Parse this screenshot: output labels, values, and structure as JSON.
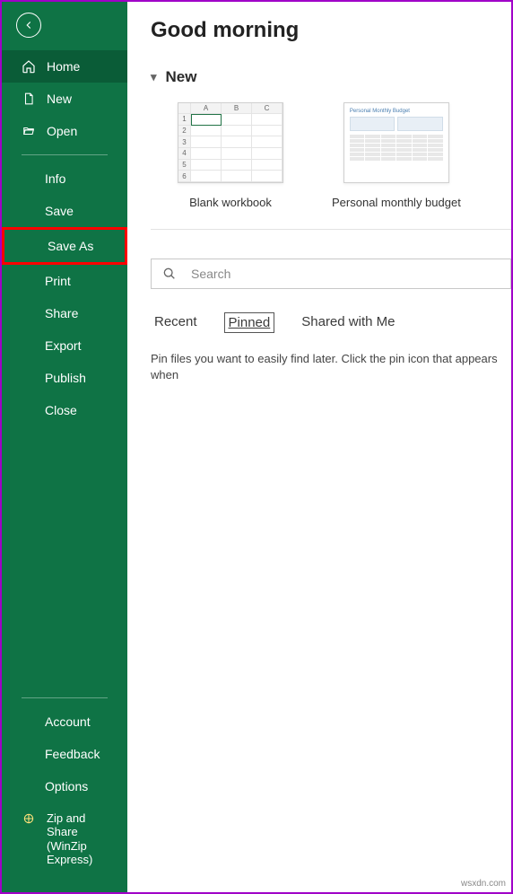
{
  "header": {
    "title": "Good morning"
  },
  "sidebar": {
    "back": "Back",
    "top": [
      {
        "label": "Home",
        "icon": "home",
        "active": true
      },
      {
        "label": "New",
        "icon": "file"
      },
      {
        "label": "Open",
        "icon": "folder"
      }
    ],
    "middle": [
      {
        "label": "Info"
      },
      {
        "label": "Save"
      },
      {
        "label": "Save As",
        "highlighted": true
      },
      {
        "label": "Print"
      },
      {
        "label": "Share"
      },
      {
        "label": "Export"
      },
      {
        "label": "Publish"
      },
      {
        "label": "Close"
      }
    ],
    "bottom": [
      {
        "label": "Account"
      },
      {
        "label": "Feedback"
      },
      {
        "label": "Options"
      }
    ],
    "zip": {
      "label": "Zip and Share (WinZip Express)"
    }
  },
  "newSection": {
    "heading": "New",
    "templates": [
      {
        "caption": "Blank workbook"
      },
      {
        "caption": "Personal monthly budget"
      }
    ]
  },
  "search": {
    "placeholder": "Search"
  },
  "fileTabs": {
    "items": [
      {
        "label": "Recent"
      },
      {
        "label": "Pinned",
        "selected": true
      },
      {
        "label": "Shared with Me"
      }
    ],
    "emptyMessage": "Pin files you want to easily find later. Click the pin icon that appears when"
  },
  "watermark": "wsxdn.com"
}
